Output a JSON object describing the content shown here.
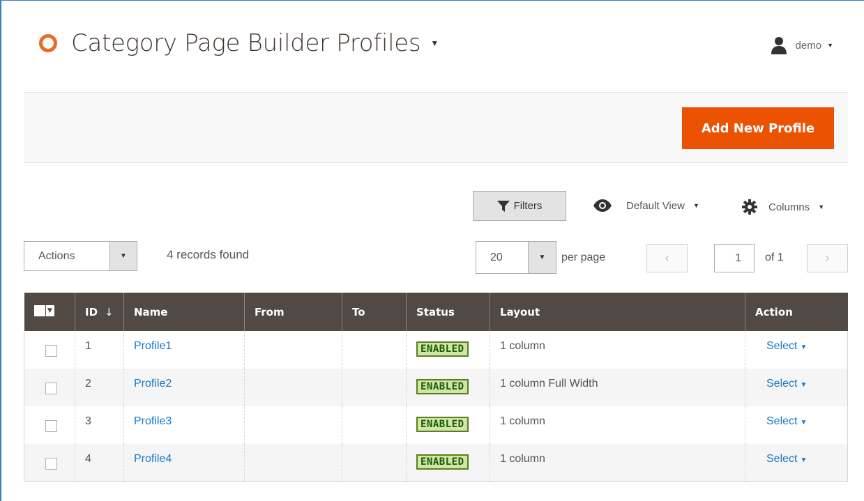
{
  "header": {
    "title": "Category Page Builder Profiles",
    "user": "demo"
  },
  "action_bar": {
    "add_button": "Add New Profile"
  },
  "toolbar": {
    "filters": "Filters",
    "default_view": "Default View",
    "columns": "Columns",
    "actions": "Actions",
    "records_found": "4 records found",
    "per_page_value": "20",
    "per_page_label": "per page",
    "page_value": "1",
    "page_of": "of 1",
    "prev_symbol": "‹",
    "next_symbol": "›"
  },
  "grid": {
    "columns": [
      "ID",
      "Name",
      "From",
      "To",
      "Status",
      "Layout",
      "Action"
    ],
    "sort_indicator": "↓",
    "rows": [
      {
        "id": "1",
        "name": "Profile1",
        "from": "",
        "to": "",
        "status": "ENABLED",
        "layout": "1 column",
        "action": "Select"
      },
      {
        "id": "2",
        "name": "Profile2",
        "from": "",
        "to": "",
        "status": "ENABLED",
        "layout": "1 column Full Width",
        "action": "Select"
      },
      {
        "id": "3",
        "name": "Profile3",
        "from": "",
        "to": "",
        "status": "ENABLED",
        "layout": "1 column",
        "action": "Select"
      },
      {
        "id": "4",
        "name": "Profile4",
        "from": "",
        "to": "",
        "status": "ENABLED",
        "layout": "1 column",
        "action": "Select"
      }
    ]
  },
  "colors": {
    "accent": "#eb5202",
    "header_bg": "#514943",
    "link": "#1979c3",
    "status_bg": "#d0e5a9"
  },
  "icons": [
    "logo-ring-icon",
    "user-icon",
    "filter-icon",
    "eye-icon",
    "gear-icon",
    "chevron-down-icon"
  ]
}
